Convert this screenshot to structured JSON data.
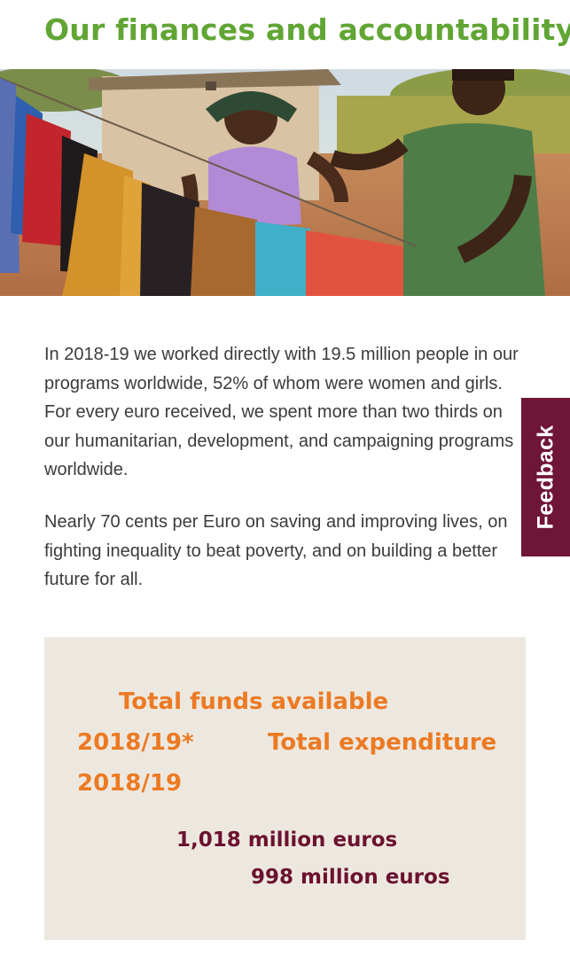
{
  "page_title": "Our finances and accountability",
  "paragraphs": [
    "In 2018-19 we worked directly with 19.5 million people in our programs worldwide, 52% of whom were women and girls. For every euro received, we spent more than two thirds on our humanitarian, development, and campaigning programs worldwide.",
    "Nearly 70 cents per Euro on saving and improving lives, on fighting inequality to beat poverty, and on building a better future for all."
  ],
  "feedback_label": "Feedback",
  "finances": {
    "funds_label_line1": "Total funds available",
    "funds_label_line2": "2018/19*",
    "expenditure_label": "Total expenditure",
    "expenditure_label_year": "2018/19",
    "funds_value": "1,018 million euros",
    "expenditure_value": "998 million euros"
  },
  "colors": {
    "title_green": "#61a534",
    "finance_orange": "#ec7a23",
    "finance_maroon": "#6b1230",
    "feedback_bg": "#6f1538",
    "box_bg": "#ede8df"
  }
}
